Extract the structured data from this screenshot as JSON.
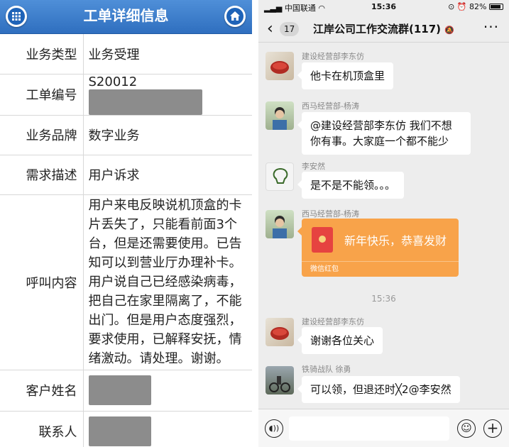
{
  "left": {
    "title": "工单详细信息",
    "icons": {
      "left": "grid-menu-icon",
      "right": "home-icon"
    },
    "rows": [
      {
        "label": "业务类型",
        "value": "业务受理"
      },
      {
        "label": "工单编号",
        "value": "S20012"
      },
      {
        "label": "业务品牌",
        "value": "数字业务"
      },
      {
        "label": "需求描述",
        "value": "用户诉求"
      },
      {
        "label": "呼叫内容",
        "value": "用户来电反映说机顶盒的卡片丢失了，只能看前面3个台，但是还需要使用。已告知可以到营业厅办理补卡。用户说自己已经感染病毒，把自己在家里隔离了，不能出门。但是用户态度强烈，要求使用，已解释安抚，情绪激动。请处理。谢谢。"
      },
      {
        "label": "客户姓名",
        "value": ""
      },
      {
        "label": "联系人",
        "value": ""
      }
    ]
  },
  "right": {
    "status": {
      "carrier": "中国联通",
      "time": "15:36",
      "battery": "82%"
    },
    "nav": {
      "back_count": "17",
      "title": "江岸公司工作交流群(117)",
      "more": "···"
    },
    "messages": [
      {
        "sender": "建设经营部李东仿",
        "text": "他卡在机顶盒里"
      },
      {
        "sender": "西马经营部-杨涛",
        "text": "@建设经营部李东仿 我们不想你有事。大家庭一个都不能少"
      },
      {
        "sender": "李安然",
        "text": "是不是不能领。。。"
      },
      {
        "sender": "西马经营部-杨涛",
        "redpacket": {
          "text": "新年快乐，恭喜发财",
          "footer": "微信红包"
        }
      },
      {
        "sender": "建设经营部李东仿",
        "text": "谢谢各位关心"
      },
      {
        "sender": "铁骑战队 徐勇",
        "text": "可以领，但退还时╳2@李安然"
      }
    ],
    "timestamp": "15:36",
    "input": {
      "voice_icon": "voice-icon",
      "emoji_icon": "emoji-icon",
      "plus_icon": "plus-icon"
    }
  }
}
